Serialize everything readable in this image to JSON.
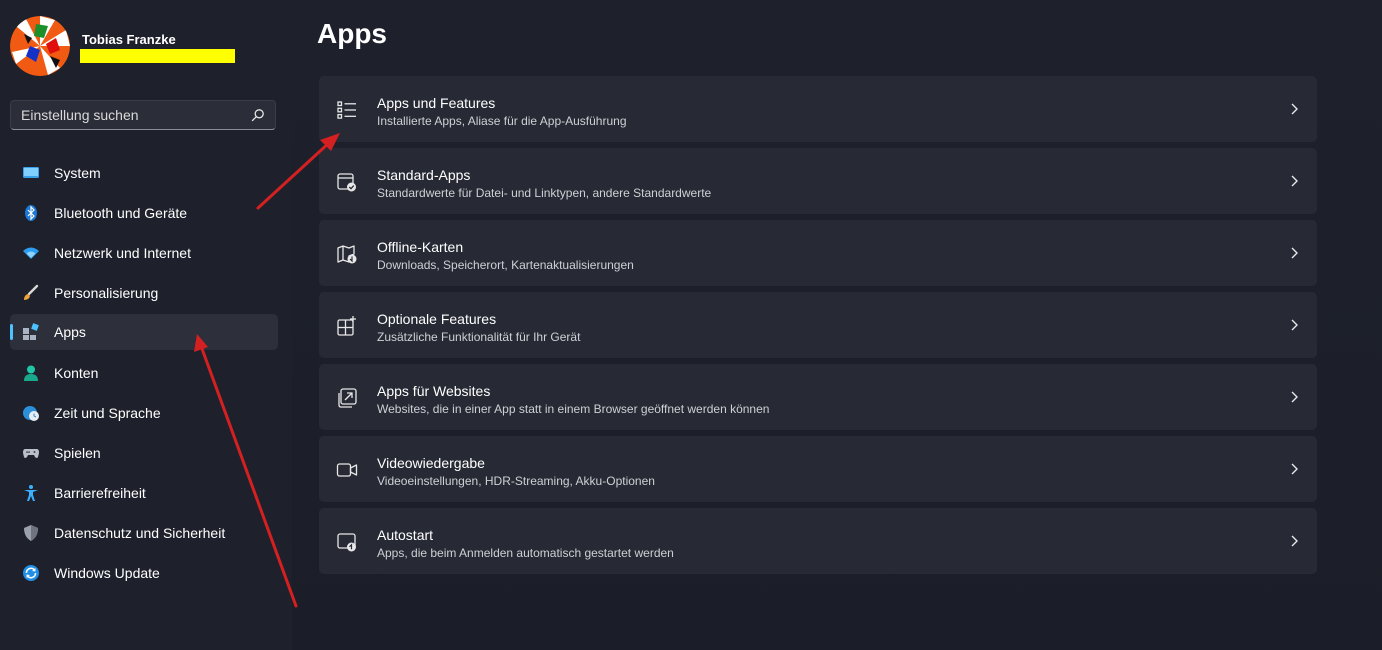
{
  "user": {
    "name": "Tobias Franzke"
  },
  "search": {
    "placeholder": "Einstellung suchen"
  },
  "sidebar": {
    "items": [
      {
        "label": "System",
        "icon": "monitor-icon"
      },
      {
        "label": "Bluetooth und Geräte",
        "icon": "bluetooth-icon"
      },
      {
        "label": "Netzwerk und Internet",
        "icon": "wifi-icon"
      },
      {
        "label": "Personalisierung",
        "icon": "brush-icon"
      },
      {
        "label": "Apps",
        "icon": "apps-icon",
        "active": true
      },
      {
        "label": "Konten",
        "icon": "person-icon"
      },
      {
        "label": "Zeit und Sprache",
        "icon": "globe-clock-icon"
      },
      {
        "label": "Spielen",
        "icon": "gamepad-icon"
      },
      {
        "label": "Barrierefreiheit",
        "icon": "accessibility-icon"
      },
      {
        "label": "Datenschutz und Sicherheit",
        "icon": "shield-icon"
      },
      {
        "label": "Windows Update",
        "icon": "update-icon"
      }
    ]
  },
  "main": {
    "title": "Apps",
    "cards": [
      {
        "title": "Apps und Features",
        "subtitle": "Installierte Apps, Aliase für die App-Ausführung",
        "icon": "list-icon"
      },
      {
        "title": "Standard-Apps",
        "subtitle": "Standardwerte für Datei- und Linktypen, andere Standardwerte",
        "icon": "default-apps-icon"
      },
      {
        "title": "Offline-Karten",
        "subtitle": "Downloads, Speicherort, Kartenaktualisierungen",
        "icon": "map-download-icon"
      },
      {
        "title": "Optionale Features",
        "subtitle": "Zusätzliche Funktionalität für Ihr Gerät",
        "icon": "add-grid-icon"
      },
      {
        "title": "Apps für Websites",
        "subtitle": "Websites, die in einer App statt in einem Browser geöffnet werden können",
        "icon": "open-in-app-icon"
      },
      {
        "title": "Videowiedergabe",
        "subtitle": "Videoeinstellungen, HDR-Streaming, Akku-Optionen",
        "icon": "video-icon"
      },
      {
        "title": "Autostart",
        "subtitle": "Apps, die beim Anmelden automatisch gestartet werden",
        "icon": "startup-icon"
      }
    ]
  },
  "colors": {
    "accent": "#4cc2ff",
    "annotation_arrow": "#d42020",
    "redaction": "#ffff00"
  }
}
